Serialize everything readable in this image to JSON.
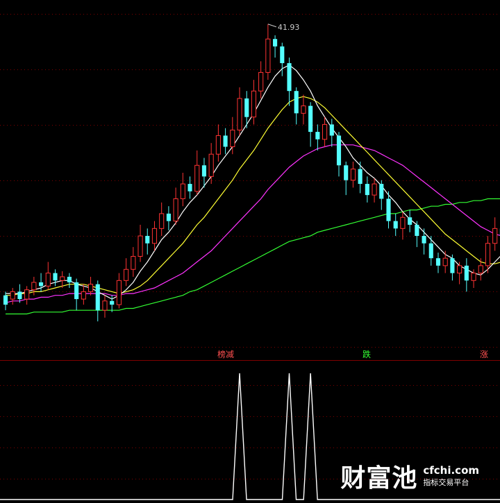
{
  "chart": {
    "high_label": "41.93",
    "signal_labels": [
      {
        "text": "榜减",
        "color": "#ff5050"
      },
      {
        "text": "跌",
        "color": "#33ff33"
      },
      {
        "text": "涨",
        "color": "#ff5050"
      }
    ]
  },
  "colors": {
    "background": "#000000",
    "up_candle": "#ff3333",
    "down_candle": "#54ffff",
    "ma_short": "#ffffff",
    "ma_mid": "#ffff33",
    "ma_long": "#ff33ff",
    "ma_longest": "#33ff33",
    "grid": "#800000",
    "indicator_line": "#ffffff"
  },
  "watermark": {
    "brand": "财富池",
    "domain": "cfchi.com",
    "tagline": "指标交易平台"
  },
  "chart_data": {
    "type": "candlestick",
    "candles": [
      {
        "o": 360,
        "c": 355,
        "h": 362,
        "l": 352
      },
      {
        "o": 358,
        "c": 362,
        "h": 364,
        "l": 355
      },
      {
        "o": 362,
        "c": 358,
        "h": 366,
        "l": 356
      },
      {
        "o": 358,
        "c": 363,
        "h": 365,
        "l": 355
      },
      {
        "o": 363,
        "c": 367,
        "h": 370,
        "l": 360
      },
      {
        "o": 367,
        "c": 365,
        "h": 372,
        "l": 362
      },
      {
        "o": 365,
        "c": 372,
        "h": 378,
        "l": 363
      },
      {
        "o": 372,
        "c": 368,
        "h": 374,
        "l": 365
      },
      {
        "o": 368,
        "c": 370,
        "h": 373,
        "l": 364
      },
      {
        "o": 370,
        "c": 367,
        "h": 372,
        "l": 364
      },
      {
        "o": 367,
        "c": 358,
        "h": 369,
        "l": 352
      },
      {
        "o": 358,
        "c": 362,
        "h": 366,
        "l": 355
      },
      {
        "o": 362,
        "c": 366,
        "h": 370,
        "l": 360
      },
      {
        "o": 366,
        "c": 352,
        "h": 368,
        "l": 346
      },
      {
        "o": 352,
        "c": 357,
        "h": 360,
        "l": 348
      },
      {
        "o": 357,
        "c": 355,
        "h": 360,
        "l": 351
      },
      {
        "o": 355,
        "c": 368,
        "h": 372,
        "l": 353
      },
      {
        "o": 368,
        "c": 374,
        "h": 380,
        "l": 365
      },
      {
        "o": 374,
        "c": 381,
        "h": 386,
        "l": 370
      },
      {
        "o": 381,
        "c": 392,
        "h": 398,
        "l": 378
      },
      {
        "o": 392,
        "c": 388,
        "h": 396,
        "l": 382
      },
      {
        "o": 388,
        "c": 396,
        "h": 400,
        "l": 384
      },
      {
        "o": 396,
        "c": 404,
        "h": 410,
        "l": 392
      },
      {
        "o": 404,
        "c": 400,
        "h": 408,
        "l": 395
      },
      {
        "o": 400,
        "c": 412,
        "h": 418,
        "l": 398
      },
      {
        "o": 412,
        "c": 420,
        "h": 426,
        "l": 408
      },
      {
        "o": 420,
        "c": 416,
        "h": 424,
        "l": 412
      },
      {
        "o": 416,
        "c": 430,
        "h": 438,
        "l": 414
      },
      {
        "o": 430,
        "c": 424,
        "h": 434,
        "l": 418
      },
      {
        "o": 424,
        "c": 436,
        "h": 442,
        "l": 420
      },
      {
        "o": 436,
        "c": 446,
        "h": 452,
        "l": 432
      },
      {
        "o": 446,
        "c": 440,
        "h": 450,
        "l": 436
      },
      {
        "o": 440,
        "c": 449,
        "h": 456,
        "l": 436
      },
      {
        "o": 449,
        "c": 466,
        "h": 472,
        "l": 446
      },
      {
        "o": 466,
        "c": 456,
        "h": 470,
        "l": 450
      },
      {
        "o": 456,
        "c": 470,
        "h": 476,
        "l": 452
      },
      {
        "o": 470,
        "c": 480,
        "h": 486,
        "l": 466
      },
      {
        "o": 480,
        "c": 498,
        "h": 506,
        "l": 476
      },
      {
        "o": 498,
        "c": 494,
        "h": 500,
        "l": 488
      },
      {
        "o": 494,
        "c": 485,
        "h": 496,
        "l": 478
      },
      {
        "o": 485,
        "c": 470,
        "h": 488,
        "l": 462
      },
      {
        "o": 470,
        "c": 458,
        "h": 472,
        "l": 452
      },
      {
        "o": 458,
        "c": 462,
        "h": 468,
        "l": 452
      },
      {
        "o": 462,
        "c": 448,
        "h": 464,
        "l": 440
      },
      {
        "o": 448,
        "c": 444,
        "h": 452,
        "l": 438
      },
      {
        "o": 444,
        "c": 452,
        "h": 456,
        "l": 440
      },
      {
        "o": 452,
        "c": 446,
        "h": 455,
        "l": 440
      },
      {
        "o": 446,
        "c": 430,
        "h": 448,
        "l": 424
      },
      {
        "o": 430,
        "c": 422,
        "h": 432,
        "l": 414
      },
      {
        "o": 422,
        "c": 428,
        "h": 432,
        "l": 418
      },
      {
        "o": 428,
        "c": 420,
        "h": 432,
        "l": 415
      },
      {
        "o": 420,
        "c": 414,
        "h": 424,
        "l": 410
      },
      {
        "o": 414,
        "c": 420,
        "h": 423,
        "l": 410
      },
      {
        "o": 420,
        "c": 412,
        "h": 422,
        "l": 406
      },
      {
        "o": 412,
        "c": 400,
        "h": 416,
        "l": 396
      },
      {
        "o": 400,
        "c": 396,
        "h": 404,
        "l": 392
      },
      {
        "o": 396,
        "c": 402,
        "h": 405,
        "l": 390
      },
      {
        "o": 402,
        "c": 398,
        "h": 406,
        "l": 394
      },
      {
        "o": 398,
        "c": 392,
        "h": 400,
        "l": 386
      },
      {
        "o": 392,
        "c": 388,
        "h": 396,
        "l": 382
      },
      {
        "o": 388,
        "c": 380,
        "h": 392,
        "l": 376
      },
      {
        "o": 380,
        "c": 376,
        "h": 383,
        "l": 372
      },
      {
        "o": 376,
        "c": 380,
        "h": 384,
        "l": 372
      },
      {
        "o": 380,
        "c": 372,
        "h": 382,
        "l": 368
      },
      {
        "o": 372,
        "c": 376,
        "h": 378,
        "l": 366
      },
      {
        "o": 376,
        "c": 368,
        "h": 380,
        "l": 362
      },
      {
        "o": 368,
        "c": 372,
        "h": 374,
        "l": 364
      },
      {
        "o": 372,
        "c": 376,
        "h": 380,
        "l": 368
      },
      {
        "o": 376,
        "c": 388,
        "h": 392,
        "l": 372
      },
      {
        "o": 388,
        "c": 396,
        "h": 402,
        "l": 384
      },
      {
        "o": 396,
        "c": 392,
        "h": 398,
        "l": 386
      }
    ],
    "ma_short": [
      361,
      361,
      361,
      362,
      363,
      364,
      366,
      367,
      368,
      368,
      366,
      365,
      364,
      362,
      360,
      358,
      360,
      363,
      367,
      373,
      378,
      384,
      390,
      394,
      399,
      405,
      410,
      414,
      419,
      424,
      430,
      435,
      440,
      446,
      452,
      458,
      465,
      472,
      478,
      482,
      484,
      481,
      476,
      470,
      462,
      456,
      450,
      445,
      440,
      434,
      430,
      426,
      423,
      419,
      414,
      410,
      405,
      401,
      398,
      394,
      390,
      386,
      382,
      380,
      376,
      374,
      372,
      371,
      374,
      378,
      382
    ],
    "ma_mid": [
      360,
      360,
      361,
      361,
      362,
      362,
      363,
      364,
      365,
      366,
      366,
      366,
      365,
      364,
      363,
      362,
      361,
      362,
      363,
      365,
      368,
      372,
      376,
      380,
      384,
      388,
      393,
      398,
      402,
      407,
      412,
      417,
      422,
      428,
      433,
      438,
      444,
      450,
      455,
      460,
      464,
      466,
      467,
      466,
      464,
      461,
      457,
      453,
      449,
      445,
      441,
      437,
      433,
      429,
      425,
      421,
      417,
      413,
      409,
      405,
      401,
      397,
      393,
      390,
      387,
      384,
      381,
      378,
      377,
      377,
      378
    ],
    "ma_long": [
      356,
      357,
      357,
      358,
      358,
      359,
      359,
      360,
      360,
      361,
      361,
      361,
      361,
      361,
      361,
      360,
      360,
      361,
      361,
      362,
      363,
      364,
      366,
      368,
      370,
      372,
      375,
      378,
      381,
      384,
      388,
      392,
      396,
      400,
      404,
      408,
      412,
      417,
      421,
      425,
      429,
      432,
      435,
      437,
      439,
      440,
      441,
      441,
      441,
      441,
      440,
      439,
      438,
      436,
      434,
      432,
      430,
      427,
      424,
      421,
      418,
      415,
      412,
      409,
      406,
      403,
      400,
      397,
      395,
      393,
      392
    ],
    "ma_longest": [
      350,
      350,
      350,
      350,
      351,
      351,
      351,
      351,
      351,
      352,
      352,
      352,
      352,
      352,
      352,
      352,
      352,
      353,
      353,
      354,
      355,
      356,
      357,
      358,
      359,
      360,
      362,
      363,
      365,
      367,
      369,
      371,
      373,
      375,
      377,
      379,
      381,
      383,
      385,
      387,
      389,
      390,
      391,
      392,
      394,
      395,
      396,
      397,
      398,
      399,
      400,
      401,
      402,
      403,
      404,
      404,
      405,
      406,
      406,
      407,
      408,
      408,
      409,
      409,
      410,
      410,
      411,
      411,
      412,
      412,
      412
    ],
    "ylim": [
      336,
      516
    ],
    "indicator": {
      "peaks_at_index": [
        33,
        40,
        43
      ],
      "ylim": [
        0,
        1
      ]
    }
  }
}
